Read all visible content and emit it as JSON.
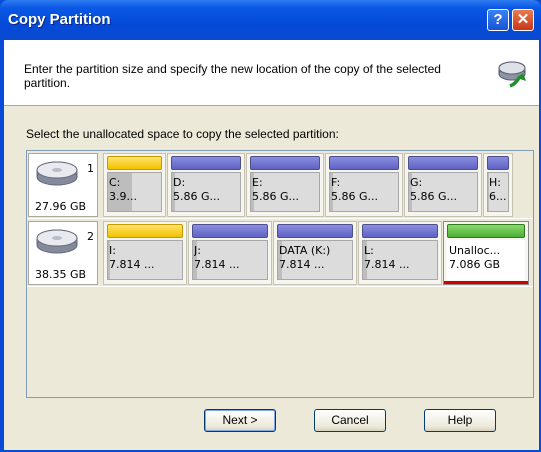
{
  "window": {
    "title": "Copy Partition"
  },
  "titlebar_buttons": {
    "help_label": "?",
    "close_label": "✕"
  },
  "header": {
    "text": "Enter the partition size and specify the new location of the copy of the selected partition.",
    "icon": "copy-disk-icon"
  },
  "map": {
    "label": "Select the unallocated space to copy the selected partition:",
    "disks": [
      {
        "number": "1",
        "size": "27.96 GB",
        "partitions": [
          {
            "line1": "C:",
            "line2": "3.9...",
            "color": "yellow",
            "used": 0.45
          },
          {
            "line1": "D:",
            "line2": "5.86 G...",
            "color": "blue",
            "used": 0.05
          },
          {
            "line1": "E:",
            "line2": "5.86 G...",
            "color": "blue",
            "used": 0.05
          },
          {
            "line1": "F:",
            "line2": "5.86 G...",
            "color": "blue",
            "used": 0.05
          },
          {
            "line1": "G:",
            "line2": "5.86 G...",
            "color": "blue",
            "used": 0.05
          },
          {
            "line1": "H:",
            "line2": "6...",
            "color": "blue",
            "used": 0.05
          }
        ]
      },
      {
        "number": "2",
        "size": "38.35 GB",
        "partitions": [
          {
            "line1": "I:",
            "line2": "7.814 ...",
            "color": "yellow",
            "used": 0.03
          },
          {
            "line1": "J:",
            "line2": "7.814 ...",
            "color": "blue",
            "used": 0.05
          },
          {
            "line1": "DATA (K:)",
            "line2": "7.814 ...",
            "color": "blue",
            "used": 0.05
          },
          {
            "line1": "L:",
            "line2": "7.814 ...",
            "color": "blue",
            "used": 0.05
          },
          {
            "line1": "Unalloc...",
            "line2": "7.086 GB",
            "color": "green",
            "used": 0
          }
        ]
      }
    ]
  },
  "buttons": {
    "next": "Next >",
    "cancel": "Cancel",
    "help": "Help"
  },
  "colors": {
    "title_blue": "#0a4ad8",
    "panel": "#ece9d8",
    "close_red": "#c7361a",
    "unalloc_border": "#d00000"
  }
}
